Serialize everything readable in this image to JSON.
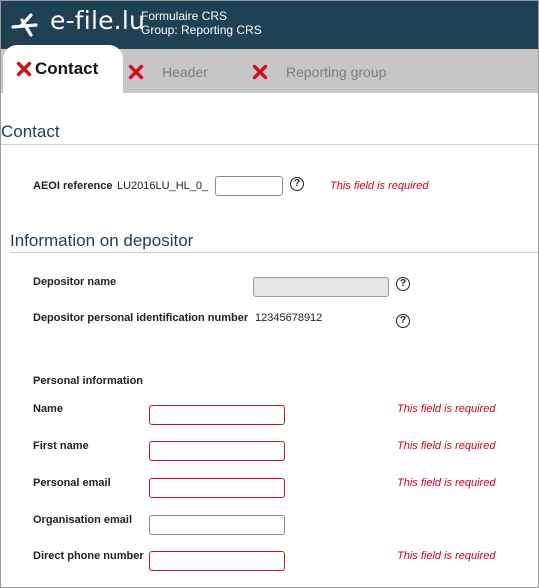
{
  "header": {
    "logo_text": "e-file.lu",
    "form_name": "Formulaire CRS",
    "group_name": "Group: Reporting CRS"
  },
  "tabs": [
    {
      "label": "Contact",
      "status_icon": "red-x-icon",
      "active": true
    },
    {
      "label": "Header",
      "status_icon": "red-x-icon",
      "active": false
    },
    {
      "label": "Reporting group",
      "status_icon": "red-x-icon",
      "active": false
    }
  ],
  "colors": {
    "brand": "#1e4155",
    "error": "#d8001c",
    "tab_bg": "#c6c6c6"
  },
  "contact": {
    "title": "Contact",
    "aeoi_label": "AEOI reference",
    "aeoi_prefix": "LU2016LU_HL_0_",
    "aeoi_value": "",
    "aeoi_error": "This field is required"
  },
  "depositor": {
    "title": "Information on depositor",
    "name_label": "Depositor name",
    "name_value": "",
    "pin_label": "Depositor personal identification number",
    "pin_value": "12345678912"
  },
  "personal": {
    "title": "Personal information",
    "fields": [
      {
        "label": "Name",
        "value": "",
        "error": "This field is required"
      },
      {
        "label": "First name",
        "value": "",
        "error": "This field is required"
      },
      {
        "label": "Personal email",
        "value": "",
        "error": "This field is required"
      },
      {
        "label": "Organisation email",
        "value": "",
        "error": ""
      },
      {
        "label": "Direct phone number",
        "value": "",
        "error": "This field is required"
      }
    ]
  },
  "help_glyph": "?"
}
